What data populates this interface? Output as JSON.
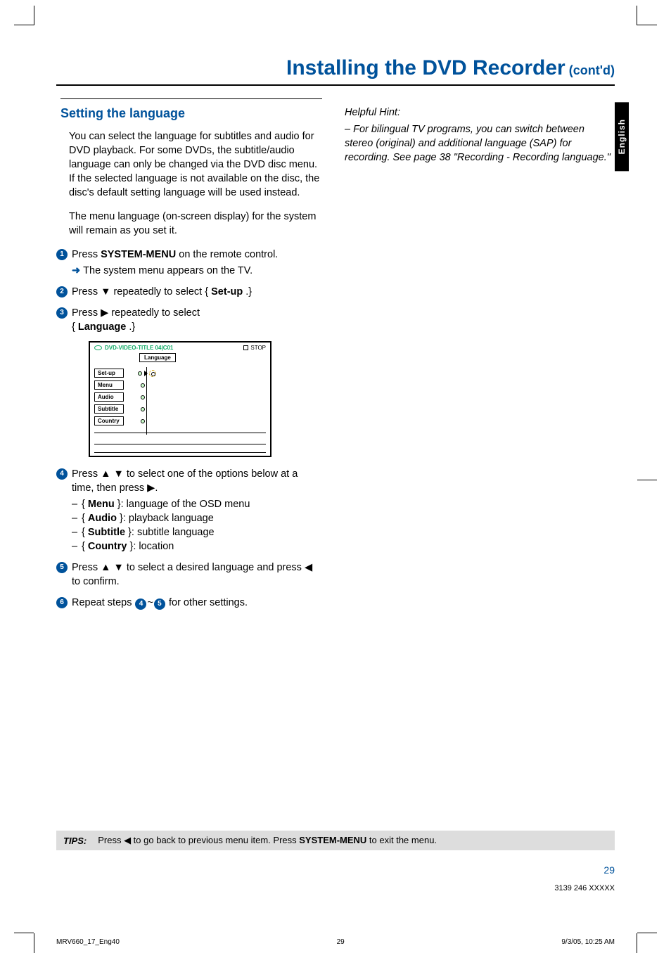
{
  "langTab": "English",
  "title": {
    "main": "Installing the DVD Recorder",
    "suffix": " (cont'd)"
  },
  "section": "Setting the language",
  "intro1": "You can select the language for subtitles and audio for DVD playback.  For some DVDs, the subtitle/audio language can only be changed via the DVD disc menu.  If the selected language is not available on the disc, the disc's default setting language will be used instead.",
  "intro2": "The menu language (on-screen display) for the system will remain as you set it.",
  "steps": {
    "s1a": "Press ",
    "s1b": "SYSTEM-MENU",
    "s1c": " on the remote control.",
    "s1res": "The system menu appears on the TV.",
    "s2a": "Press ▼ repeatedly to select { ",
    "s2b": "Set-up",
    "s2c": " .}",
    "s3a": "Press ▶ repeatedly to select",
    "s3b": "Language",
    "s3bprefix": "{ ",
    "s3bsuffix": " .}",
    "s4a": "Press ▲ ▼ to select one of the options below at a time, then press ▶.",
    "s4m1a": "Menu",
    "s4m1b": " }: language of the OSD menu",
    "s4m2a": "Audio",
    "s4m2b": " }: playback language",
    "s4m3a": "Subtitle",
    "s4m3b": " }: subtitle language",
    "s4m4a": "Country",
    "s4m4b": " }: location",
    "s5": "Press ▲ ▼ to select a desired language and press ◀ to confirm.",
    "s6a": "Repeat steps ",
    "s6b": " for other settings.",
    "tildeSep": "~"
  },
  "nums": {
    "n1": "1",
    "n2": "2",
    "n3": "3",
    "n4": "4",
    "n5": "5",
    "n6": "6"
  },
  "ui": {
    "titleLeft": "DVD-VIDEO-TITLE 04|C01",
    "stop": "STOP",
    "tab": "Language",
    "items": [
      "Set-up",
      "Menu",
      "Audio",
      "Subtitle",
      "Country"
    ]
  },
  "hint": {
    "title": "Helpful Hint:",
    "body": "–  For bilingual TV programs, you can switch between stereo (original) and additional language (SAP) for recording. See page 38 \"Recording - Recording language.\""
  },
  "tips": {
    "label": "TIPS:",
    "a": "Press ◀ to go back to previous menu item.  Press ",
    "b": "SYSTEM-MENU",
    "c": " to exit the menu."
  },
  "pageNum": "29",
  "partNum": "3139 246 XXXXX",
  "footer": {
    "left": "MRV660_17_Eng40",
    "mid": "29",
    "right": "9/3/05, 10:25 AM"
  }
}
